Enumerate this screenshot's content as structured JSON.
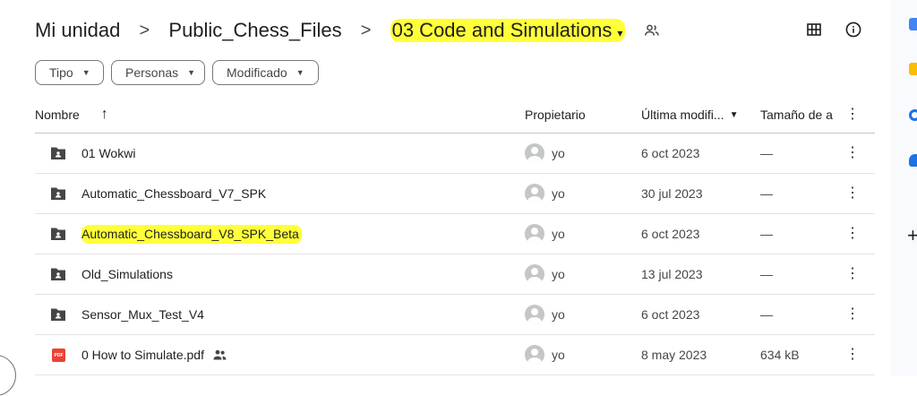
{
  "breadcrumb": {
    "root": "Mi unidad",
    "separator": ">",
    "parent": "Public_Chess_Files",
    "current": "03 Code and Simulations"
  },
  "filters": [
    {
      "label": "Tipo"
    },
    {
      "label": "Personas"
    },
    {
      "label": "Modificado"
    }
  ],
  "table": {
    "headers": {
      "name": "Nombre",
      "owner": "Propietario",
      "modified": "Última modifi...",
      "size": "Tamaño de a"
    },
    "rows": [
      {
        "name": "01 Wokwi",
        "type": "folder",
        "owner": "yo",
        "modified": "6 oct 2023",
        "size": "—"
      },
      {
        "name": "Automatic_Chessboard_V7_SPK",
        "type": "folder",
        "owner": "yo",
        "modified": "30 jul 2023",
        "size": "—"
      },
      {
        "name": "Automatic_Chessboard_V8_SPK_Beta",
        "type": "folder",
        "owner": "yo",
        "modified": "6 oct 2023",
        "size": "—"
      },
      {
        "name": "Old_Simulations",
        "type": "folder",
        "owner": "yo",
        "modified": "13 jul 2023",
        "size": "—"
      },
      {
        "name": "Sensor_Mux_Test_V4",
        "type": "folder",
        "owner": "yo",
        "modified": "6 oct 2023",
        "size": "—"
      },
      {
        "name": "0 How to Simulate.pdf",
        "type": "pdf",
        "owner": "yo",
        "modified": "8 may 2023",
        "size": "634 kB"
      }
    ]
  },
  "icons": {
    "pdf_badge": "PDF",
    "caret": "▾",
    "kebab": "⋮",
    "sort": "↑",
    "add": "+"
  },
  "colors": {
    "highlight": "#ffff3a",
    "pdf": "#ea4335",
    "folder": "#444746"
  }
}
